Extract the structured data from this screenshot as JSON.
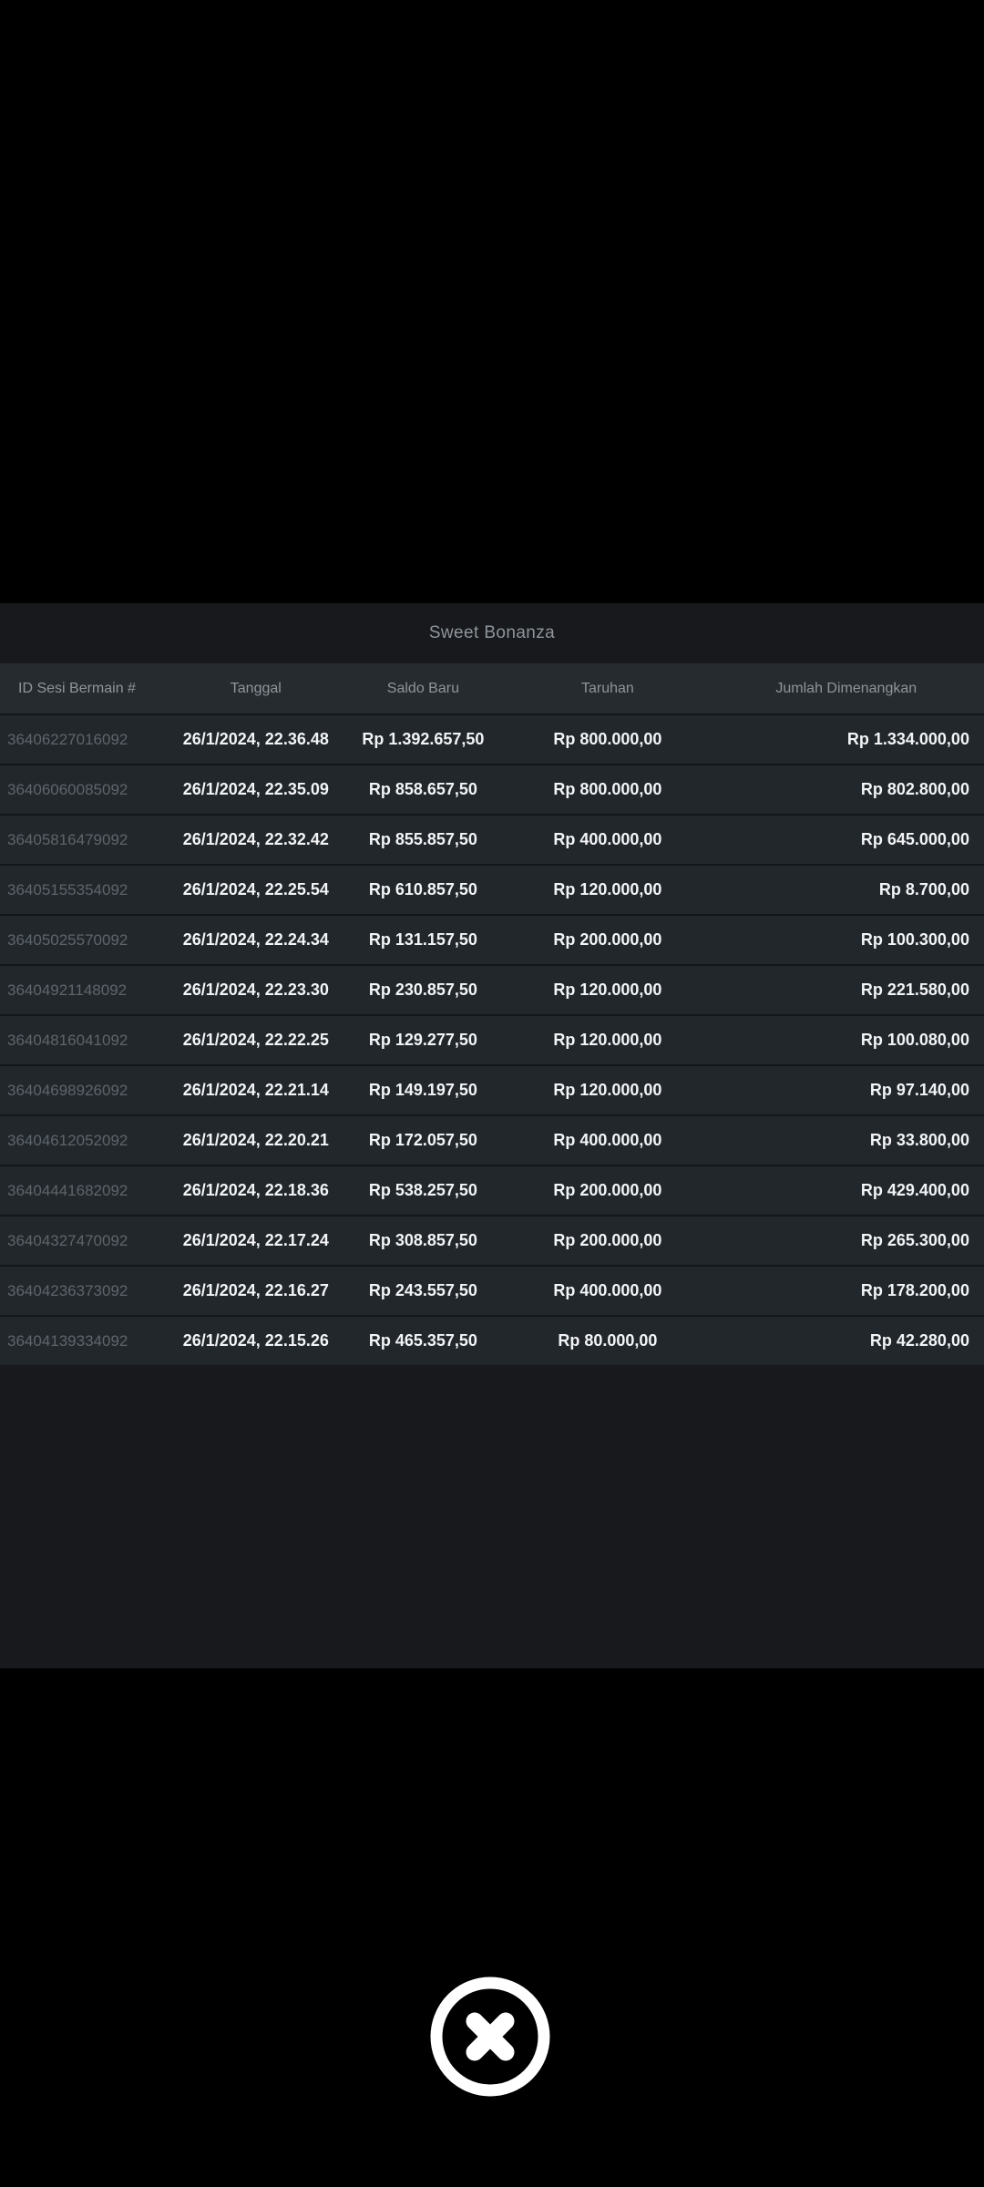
{
  "modal": {
    "title": "Sweet Bonanza"
  },
  "table": {
    "columns": [
      "ID Sesi Bermain #",
      "Tanggal",
      "Saldo Baru",
      "Taruhan",
      "Jumlah Dimenangkan"
    ],
    "rows": [
      {
        "id": "36406227016092",
        "date": "26/1/2024, 22.36.48",
        "new_balance": "Rp 1.392.657,50",
        "bet": "Rp 800.000,00",
        "amount_won": "Rp 1.334.000,00"
      },
      {
        "id": "36406060085092",
        "date": "26/1/2024, 22.35.09",
        "new_balance": "Rp 858.657,50",
        "bet": "Rp 800.000,00",
        "amount_won": "Rp 802.800,00"
      },
      {
        "id": "36405816479092",
        "date": "26/1/2024, 22.32.42",
        "new_balance": "Rp 855.857,50",
        "bet": "Rp 400.000,00",
        "amount_won": "Rp 645.000,00"
      },
      {
        "id": "36405155354092",
        "date": "26/1/2024, 22.25.54",
        "new_balance": "Rp 610.857,50",
        "bet": "Rp 120.000,00",
        "amount_won": "Rp 8.700,00"
      },
      {
        "id": "36405025570092",
        "date": "26/1/2024, 22.24.34",
        "new_balance": "Rp 131.157,50",
        "bet": "Rp 200.000,00",
        "amount_won": "Rp 100.300,00"
      },
      {
        "id": "36404921148092",
        "date": "26/1/2024, 22.23.30",
        "new_balance": "Rp 230.857,50",
        "bet": "Rp 120.000,00",
        "amount_won": "Rp 221.580,00"
      },
      {
        "id": "36404816041092",
        "date": "26/1/2024, 22.22.25",
        "new_balance": "Rp 129.277,50",
        "bet": "Rp 120.000,00",
        "amount_won": "Rp 100.080,00"
      },
      {
        "id": "36404698926092",
        "date": "26/1/2024, 22.21.14",
        "new_balance": "Rp 149.197,50",
        "bet": "Rp 120.000,00",
        "amount_won": "Rp 97.140,00"
      },
      {
        "id": "36404612052092",
        "date": "26/1/2024, 22.20.21",
        "new_balance": "Rp 172.057,50",
        "bet": "Rp 400.000,00",
        "amount_won": "Rp 33.800,00"
      },
      {
        "id": "36404441682092",
        "date": "26/1/2024, 22.18.36",
        "new_balance": "Rp 538.257,50",
        "bet": "Rp 200.000,00",
        "amount_won": "Rp 429.400,00"
      },
      {
        "id": "36404327470092",
        "date": "26/1/2024, 22.17.24",
        "new_balance": "Rp 308.857,50",
        "bet": "Rp 200.000,00",
        "amount_won": "Rp 265.300,00"
      },
      {
        "id": "36404236373092",
        "date": "26/1/2024, 22.16.27",
        "new_balance": "Rp 243.557,50",
        "bet": "Rp 400.000,00",
        "amount_won": "Rp 178.200,00"
      },
      {
        "id": "36404139334092",
        "date": "26/1/2024, 22.15.26",
        "new_balance": "Rp 465.357,50",
        "bet": "Rp 80.000,00",
        "amount_won": "Rp 42.280,00"
      }
    ]
  },
  "close_button": {
    "icon": "close-icon"
  },
  "colors": {
    "background": "#000000",
    "panel_bg": "#17191c",
    "title_bar_bg": "#18191d",
    "header_bg": "#262b2f",
    "row_bg": "#22272b",
    "separator": "#14171a",
    "text_primary": "#f2f4f6",
    "text_muted": "#8d959b",
    "text_id": "#5d656c",
    "close_icon": "#ffffff"
  }
}
